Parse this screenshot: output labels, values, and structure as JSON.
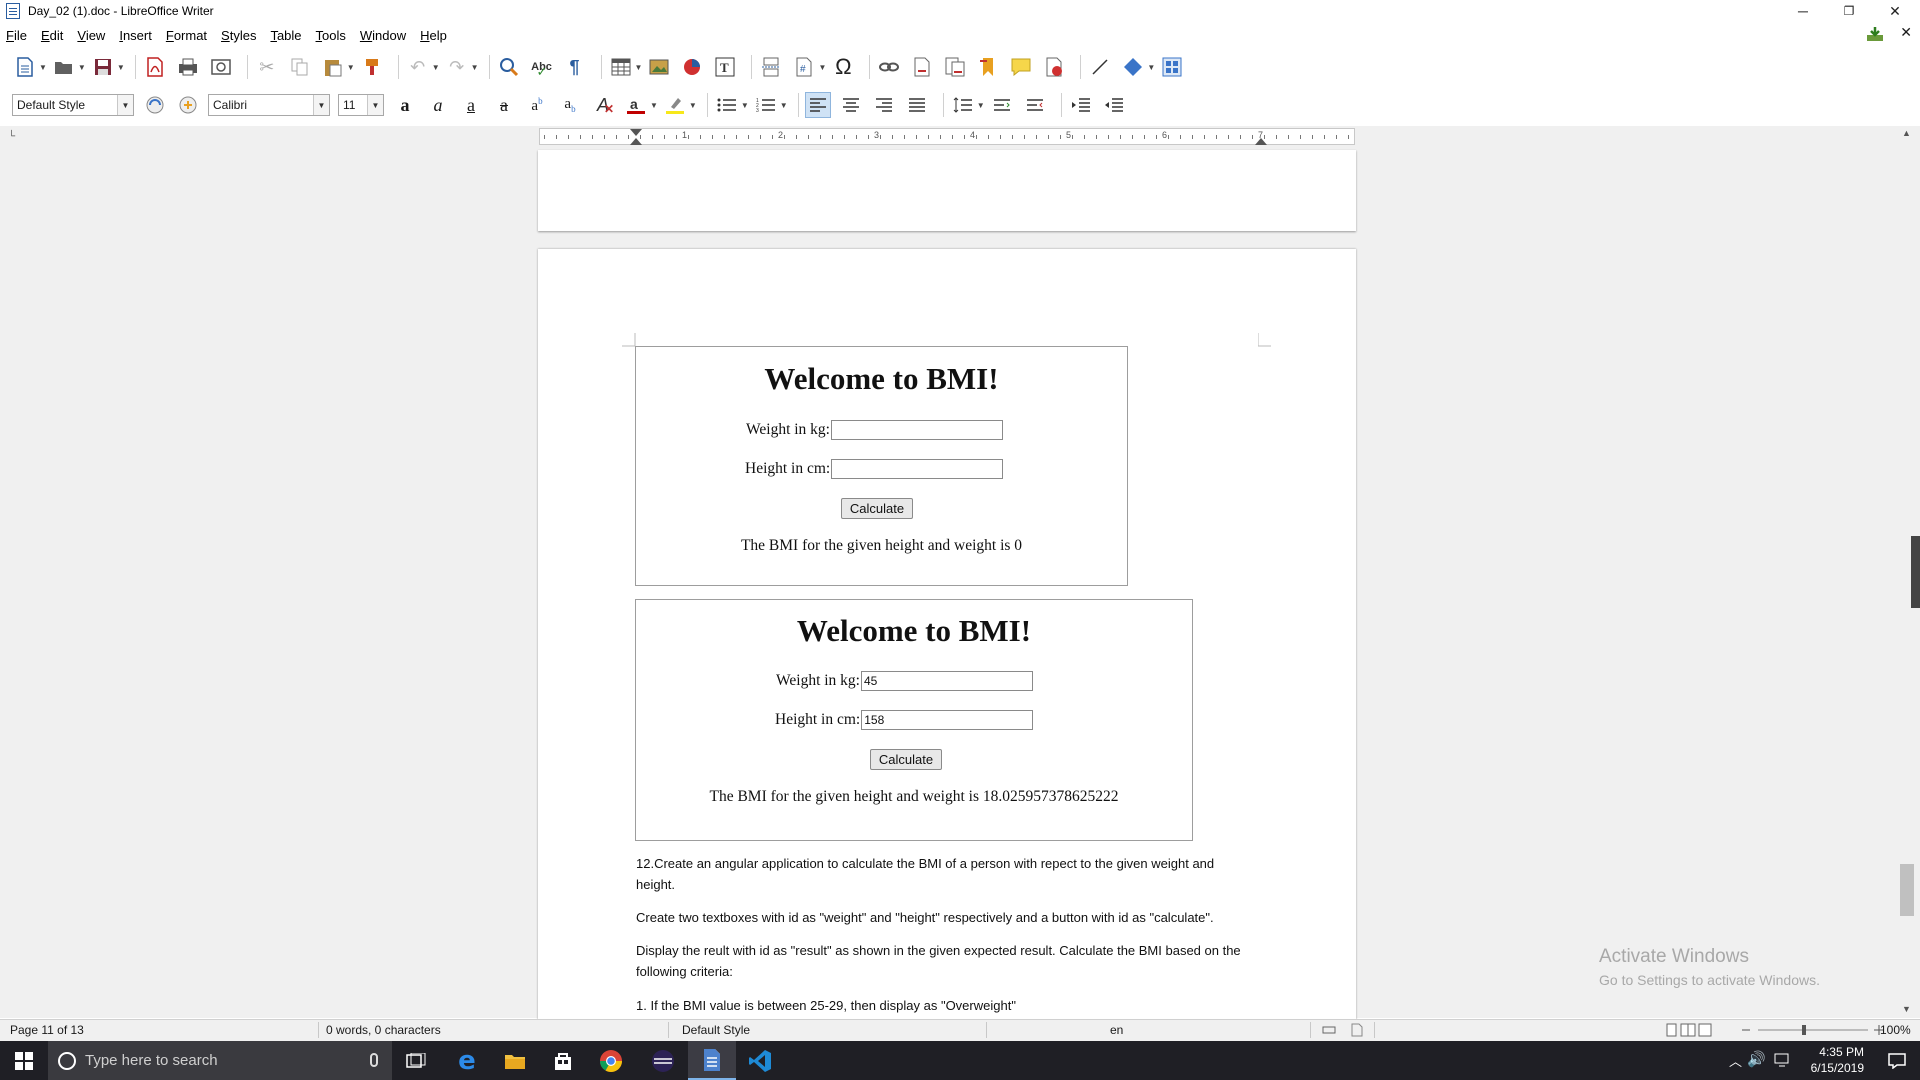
{
  "window": {
    "title": "Day_02 (1).doc - LibreOffice Writer",
    "controls": {
      "minimize": "─",
      "restore": "❐",
      "close": "✕"
    }
  },
  "menu": {
    "items": [
      "File",
      "Edit",
      "View",
      "Insert",
      "Format",
      "Styles",
      "Table",
      "Tools",
      "Window",
      "Help"
    ],
    "close_doc": "✕"
  },
  "formatting": {
    "paragraph_style": "Default Style",
    "font_name": "Calibri",
    "font_size": "11"
  },
  "ruler": {
    "numbers": [
      "1",
      "2",
      "3",
      "4",
      "5",
      "6",
      "7"
    ]
  },
  "document": {
    "bmi_empty": {
      "title": "Welcome to BMI!",
      "weight_label": "Weight in kg:",
      "height_label": "Height in cm:",
      "weight_value": "",
      "height_value": "",
      "button": "Calculate",
      "result": "The BMI for the given height and weight is 0"
    },
    "bmi_filled": {
      "title": "Welcome to BMI!",
      "weight_label": "Weight in kg:",
      "height_label": "Height in cm:",
      "weight_value": "45",
      "height_value": "158",
      "button": "Calculate",
      "result": "The BMI for the given height and weight is 18.025957378625222"
    },
    "paragraphs": [
      "12.Create an angular application to calculate the BMI of a person with repect to the given weight and height.",
      "Create two textboxes with id as \"weight\" and \"height\" respectively and a button with id as \"calculate\".",
      "Display the reult with id as \"result\" as shown in the given expected result. Calculate the BMI based on the following criteria:",
      "1. If the BMI value is between 25-29, then display as \"Overweight\""
    ]
  },
  "watermark": {
    "line1": "Activate Windows",
    "line2": "Go to Settings to activate Windows."
  },
  "statusbar": {
    "page": "Page 11 of 13",
    "words": "0 words, 0 characters",
    "page_style": "Default Style",
    "language": "en",
    "zoom": "100%"
  },
  "taskbar": {
    "search_placeholder": "Type here to search",
    "time": "4:35 PM",
    "date": "6/15/2019"
  },
  "colors": {
    "taskbar": "#1f1f25",
    "workspace": "#f0f0f0",
    "accent": "#7eb4ea"
  }
}
